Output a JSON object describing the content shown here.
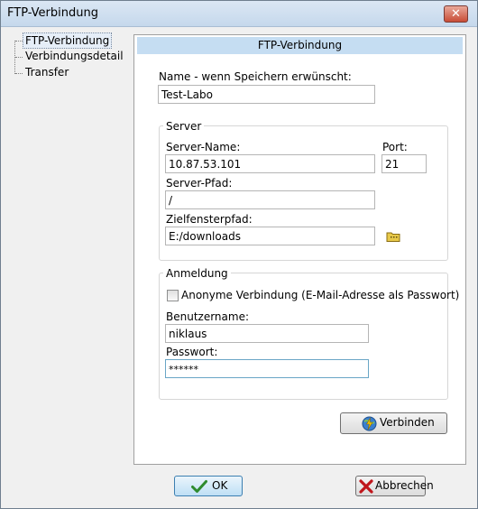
{
  "window": {
    "title": "FTP-Verbindung",
    "close_glyph": "✕"
  },
  "tree": {
    "items": [
      {
        "label": "FTP-Verbindung",
        "selected": true
      },
      {
        "label": "Verbindungsdetail",
        "selected": false
      },
      {
        "label": "Transfer",
        "selected": false
      }
    ]
  },
  "panel": {
    "header": "FTP-Verbindung",
    "name_label": "Name - wenn Speichern erwünscht:",
    "name_value": "Test-Labo",
    "server_group": {
      "title": "Server",
      "server_name_label": "Server-Name:",
      "server_name_value": "10.87.53.101",
      "port_label": "Port:",
      "port_value": "21",
      "server_path_label": "Server-Pfad:",
      "server_path_value": "/",
      "target_path_label": "Zielfensterpfad:",
      "target_path_value": "E:/downloads",
      "browse_icon": "folder-icon"
    },
    "login_group": {
      "title": "Anmeldung",
      "anonymous_label": "Anonyme Verbindung (E-Mail-Adresse als Passwort)",
      "anonymous_checked": false,
      "username_label": "Benutzername:",
      "username_value": "niklaus",
      "password_label": "Passwort:",
      "password_value": "******"
    },
    "connect_button": {
      "label": "Verbinden",
      "icon": "lightning-globe-icon"
    }
  },
  "footer": {
    "ok_button": {
      "label": "OK",
      "icon": "checkmark-icon"
    },
    "cancel_button": {
      "label": "Abbrechen",
      "icon": "cross-icon"
    }
  },
  "colors": {
    "title_bar": "#c5d8ec",
    "panel_header": "#c5ddf2",
    "checkmark": "#2e8b2e",
    "cross": "#c0151b",
    "folder": "#e8c94a"
  }
}
